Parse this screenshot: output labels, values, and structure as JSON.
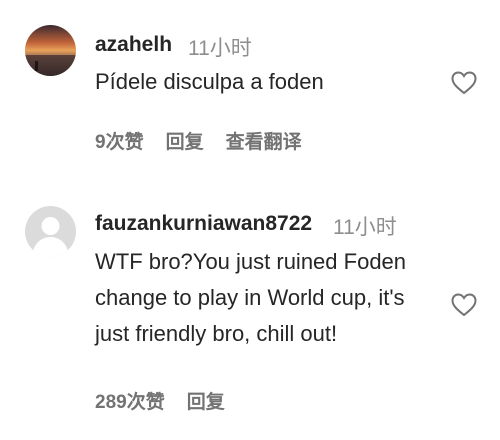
{
  "comments": [
    {
      "username": "azahelh",
      "time": "11小时",
      "text": "Pídele disculpa a foden",
      "likes": "9次赞",
      "reply": "回复",
      "translate": "查看翻译",
      "icons": {
        "like": "heart-icon"
      }
    },
    {
      "username": "fauzankurniawan8722",
      "time": "11小时",
      "text": "WTF bro?You just ruined Foden change to play in World cup, it's just friendly bro, chill out!",
      "likes": "289次赞",
      "reply": "回复",
      "icons": {
        "like": "heart-icon"
      }
    }
  ],
  "colors": {
    "text": "#262626",
    "secondary": "#8e8e8e",
    "action": "#737373",
    "avatar_placeholder_bg": "#dbdbdb",
    "avatar_placeholder_fg": "#ffffff"
  }
}
